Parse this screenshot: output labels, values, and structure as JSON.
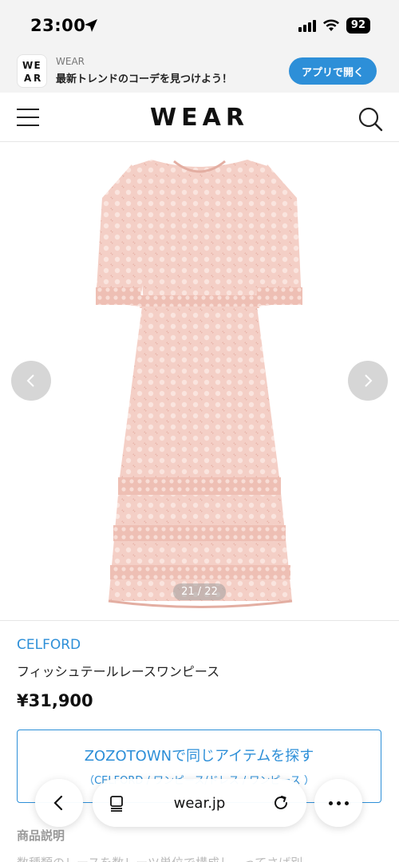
{
  "status": {
    "time": "23:00",
    "battery": "92"
  },
  "app_banner": {
    "logo_letters": [
      "W",
      "E",
      "A",
      "R"
    ],
    "name": "WEAR",
    "tagline": "最新トレンドのコーデを見つけよう！",
    "open_button": "アプリで開く"
  },
  "header": {
    "logo": "WEAR"
  },
  "gallery": {
    "counter": "21 / 22"
  },
  "product": {
    "brand": "CELFORD",
    "name": "フィッシュテールレースワンピース",
    "price": "¥31,900"
  },
  "zozo": {
    "title": "ZOZOTOWNで同じアイテムを探す",
    "subtitle": "（CELFORD / ワンピース/ドレス / ワンピース ）"
  },
  "description": {
    "title": "商品説明",
    "text": "数種類のレースを数レーツ単位で構成し、ってさば別"
  },
  "browser": {
    "url": "wear.jp"
  },
  "colors": {
    "accent": "#2d8fd8",
    "dress": "#f2c9c0"
  }
}
